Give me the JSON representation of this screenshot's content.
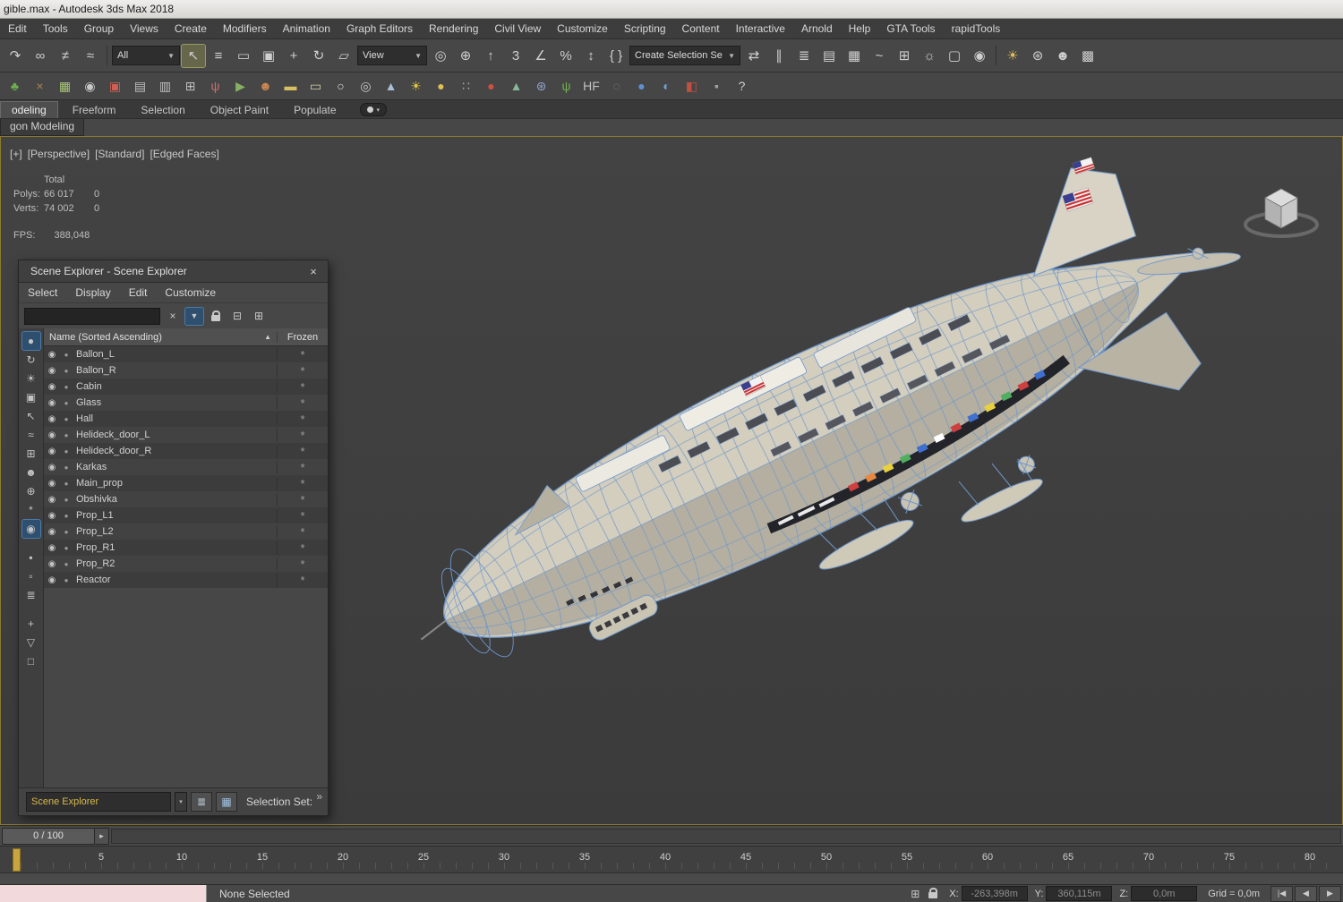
{
  "ui": {
    "caret": "▼",
    "caret_small": "▾",
    "close": "×",
    "sort_asc": "▲",
    "more": "»",
    "step": "▸",
    "clear": "×"
  },
  "window": {
    "title": "gible.max - Autodesk 3ds Max 2018"
  },
  "menubar": {
    "items": [
      "Edit",
      "Tools",
      "Group",
      "Views",
      "Create",
      "Modifiers",
      "Animation",
      "Graph Editors",
      "Rendering",
      "Civil View",
      "Customize",
      "Scripting",
      "Content",
      "Interactive",
      "Arnold",
      "Help",
      "GTA Tools",
      "rapidTools"
    ]
  },
  "toolbar_main": {
    "icons_a": [
      {
        "n": "redo-icon",
        "g": "↷"
      },
      {
        "n": "select-and-link-icon",
        "g": "∞"
      },
      {
        "n": "unlink-selection-icon",
        "g": "≠"
      },
      {
        "n": "bind-to-spacewarp-icon",
        "g": "≈"
      }
    ],
    "selection_filter": {
      "value": "All"
    },
    "icons_b": [
      {
        "n": "select-object-icon",
        "g": "↖",
        "cls": "active"
      },
      {
        "n": "select-by-name-icon",
        "g": "≡"
      },
      {
        "n": "rectangular-selection-region-icon",
        "g": "▭"
      },
      {
        "n": "window-crossing-icon",
        "g": "▣"
      },
      {
        "n": "select-and-move-icon",
        "g": "+"
      },
      {
        "n": "select-and-rotate-icon",
        "g": "↻"
      },
      {
        "n": "select-and-scale-icon",
        "g": "▱"
      }
    ],
    "ref_coord": {
      "value": "View"
    },
    "icons_c": [
      {
        "n": "use-pivot-point-icon",
        "g": "◎"
      },
      {
        "n": "select-and-manipulate-icon",
        "g": "⊕"
      },
      {
        "n": "keyboard-shortcut-override-icon",
        "g": "↑"
      },
      {
        "n": "snaps-toggle-icon",
        "g": "3"
      },
      {
        "n": "angle-snap-icon",
        "g": "∠"
      },
      {
        "n": "percent-snap-icon",
        "g": "%"
      },
      {
        "n": "spinner-snap-icon",
        "g": "↕"
      },
      {
        "n": "edit-named-selection-sets-icon",
        "g": "{ }"
      }
    ],
    "named_selection": {
      "value": "Create Selection Se"
    },
    "icons_d": [
      {
        "n": "mirror-icon",
        "g": "⇄"
      },
      {
        "n": "align-icon",
        "g": "∥"
      },
      {
        "n": "layer-explorer-icon",
        "g": "≣"
      },
      {
        "n": "toggle-ribbon-icon",
        "g": "▤"
      },
      {
        "n": "scene-explorer-toggle-icon",
        "g": "▦"
      },
      {
        "n": "curve-editor-icon",
        "g": "~"
      },
      {
        "n": "schematic-view-icon",
        "g": "⊞"
      },
      {
        "n": "render-setup-icon",
        "g": "☼"
      },
      {
        "n": "rendered-frame-window-icon",
        "g": "▢"
      },
      {
        "n": "render-production-icon",
        "g": "◉"
      }
    ],
    "icons_e": [
      {
        "n": "default-lighting-icon",
        "g": "☀",
        "c": "#e0c05a"
      },
      {
        "n": "environment-icon",
        "g": "⊛"
      },
      {
        "n": "asset-tracking-icon",
        "g": "☻"
      },
      {
        "n": "state-sets-icon",
        "g": "▩"
      }
    ]
  },
  "toolbar_secondary": {
    "icons": [
      {
        "n": "vegetation-icon",
        "g": "♣",
        "c": "#6fae4e"
      },
      {
        "n": "axe-icon",
        "g": "×",
        "c": "#b08050"
      },
      {
        "n": "table-icon",
        "g": "▦",
        "c": "#a8c878"
      },
      {
        "n": "eye-toggle-icon",
        "g": "◉",
        "c": "#c8c8c8"
      },
      {
        "n": "camera-icon",
        "g": "▣",
        "c": "#d06050"
      },
      {
        "n": "monitor-icon",
        "g": "▤",
        "c": "#c0c0c0"
      },
      {
        "n": "spreadsheet-icon",
        "g": "▥",
        "c": "#c0c0c0"
      },
      {
        "n": "slate-material-icon",
        "g": "⊞",
        "c": "#c0c0c0"
      },
      {
        "n": "fork-icon",
        "g": "ψ",
        "c": "#c87070"
      },
      {
        "n": "video-camera-icon",
        "g": "▶",
        "c": "#88b060"
      },
      {
        "n": "populate-people-icon",
        "g": "☻",
        "c": "#d08850"
      },
      {
        "n": "rectangle-tool-icon",
        "g": "▬",
        "c": "#d8c060"
      },
      {
        "n": "capsule-tool-icon",
        "g": "▭",
        "c": "#d8d0a8"
      },
      {
        "n": "circle-tool-icon",
        "g": "○",
        "c": "#e0e0e0"
      },
      {
        "n": "geosphere-tool-icon",
        "g": "◎",
        "c": "#c8c8c8"
      },
      {
        "n": "cone-tool-icon",
        "g": "▲",
        "c": "#a8c0d8"
      },
      {
        "n": "sun-light-icon",
        "g": "☀",
        "c": "#e8c840"
      },
      {
        "n": "sphere-tool-icon",
        "g": "●",
        "c": "#e0c050"
      },
      {
        "n": "particle-array-icon",
        "g": "∷",
        "c": "#a8a8a8"
      },
      {
        "n": "red-sphere-icon",
        "g": "●",
        "c": "#d05040"
      },
      {
        "n": "terrain-icon",
        "g": "▲",
        "c": "#88b898"
      },
      {
        "n": "gear-globe-icon",
        "g": "⊛",
        "c": "#90a8d0"
      },
      {
        "n": "grass-icon",
        "g": "ψ",
        "c": "#70b050"
      },
      {
        "n": "hf-icon",
        "g": "HF",
        "c": "#c0c0c0"
      },
      {
        "n": "torus-icon",
        "g": "◌",
        "c": "#988870"
      },
      {
        "n": "blue-sphere-icon",
        "g": "●",
        "c": "#6090d0"
      },
      {
        "n": "earth-icon",
        "g": "◐",
        "c": "#70a0d0"
      },
      {
        "n": "material-red-icon",
        "g": "◧",
        "c": "#c05040"
      },
      {
        "n": "cube-small-icon",
        "g": "▪",
        "c": "#a0a0a0"
      },
      {
        "n": "help-icon",
        "g": "?",
        "c": "#d0d0d0"
      }
    ]
  },
  "ribbon": {
    "tabs": [
      {
        "n": "tab-modeling",
        "label": "odeling",
        "cls": "active"
      },
      {
        "n": "tab-freeform",
        "label": "Freeform"
      },
      {
        "n": "tab-selection",
        "label": "Selection"
      },
      {
        "n": "tab-object-paint",
        "label": "Object Paint"
      },
      {
        "n": "tab-populate",
        "label": "Populate"
      }
    ],
    "subtab": "gon Modeling"
  },
  "viewport": {
    "label": {
      "plus": "[+]",
      "view": "[Perspective]",
      "style": "[Standard]",
      "shading": "[Edged Faces]"
    },
    "stats": {
      "total": "Total",
      "polys_label": "Polys:",
      "polys": "66 017",
      "polys_b": "0",
      "verts_label": "Verts:",
      "verts": "74 002",
      "verts_b": "0",
      "fps_label": "FPS:",
      "fps": "388,048"
    }
  },
  "scene_explorer": {
    "title": "Scene Explorer - Scene Explorer",
    "menu": [
      "Select",
      "Display",
      "Edit",
      "Customize"
    ],
    "search": {
      "value": ""
    },
    "glyphs": {
      "eye": "◉",
      "dot": "●",
      "frozen": "*"
    },
    "columns": {
      "name": "Name (Sorted Ascending)",
      "frozen": "Frozen"
    },
    "rows": [
      "Ballon_L",
      "Ballon_R",
      "Cabin",
      "Glass",
      "Hall",
      "Helideck_door_L",
      "Helideck_door_R",
      "Karkas",
      "Main_prop",
      "Obshivka",
      "Prop_L1",
      "Prop_L2",
      "Prop_R1",
      "Prop_R2",
      "Reactor"
    ],
    "side_icons_a": [
      {
        "n": "display-geometry-icon",
        "g": "●",
        "cls": "active"
      },
      {
        "n": "display-shapes-icon",
        "g": "↻"
      },
      {
        "n": "display-lights-icon",
        "g": "☀"
      },
      {
        "n": "display-cameras-icon",
        "g": "▣"
      },
      {
        "n": "display-helpers-icon",
        "g": "↖"
      },
      {
        "n": "display-spacewarps-icon",
        "g": "≈"
      },
      {
        "n": "display-groups-icon",
        "g": "⊞"
      },
      {
        "n": "display-bones-icon",
        "g": "☻"
      },
      {
        "n": "display-containers-icon",
        "g": "⊕"
      },
      {
        "n": "display-frozen-icon",
        "g": "*"
      },
      {
        "n": "display-hidden-icon",
        "g": "◉",
        "cls": "active"
      }
    ],
    "side_icons_b": [
      {
        "n": "select-all-icon",
        "g": "▪"
      },
      {
        "n": "select-none-icon",
        "g": "▫"
      },
      {
        "n": "select-invert-icon",
        "g": "≣"
      }
    ],
    "side_icons_c": [
      {
        "n": "pick-parent-icon",
        "g": "+"
      },
      {
        "n": "filter-funnel-icon",
        "g": "▽"
      },
      {
        "n": "new-container-icon",
        "g": "□"
      }
    ],
    "footer": {
      "explorer_name": "Scene Explorer",
      "selection_set_label": "Selection Set:",
      "more": "»"
    }
  },
  "timeline": {
    "handle": "0 / 100",
    "ticks": [
      "5",
      "10",
      "15",
      "20",
      "25",
      "30",
      "35",
      "40",
      "45",
      "50",
      "55",
      "60",
      "65",
      "70",
      "75",
      "80"
    ]
  },
  "statusbar": {
    "prompt": "None Selected",
    "icons": {
      "absolute": "⊞"
    },
    "x_label": "X:",
    "x_value": "-263,398m",
    "y_label": "Y:",
    "y_value": "360,115m",
    "z_label": "Z:",
    "z_value": "0,0m",
    "grid": "Grid = 0,0m",
    "transport": [
      {
        "n": "go-to-start-icon",
        "g": "|◀"
      },
      {
        "n": "previous-frame-icon",
        "g": "◀"
      },
      {
        "n": "play-icon",
        "g": "▶"
      }
    ]
  }
}
